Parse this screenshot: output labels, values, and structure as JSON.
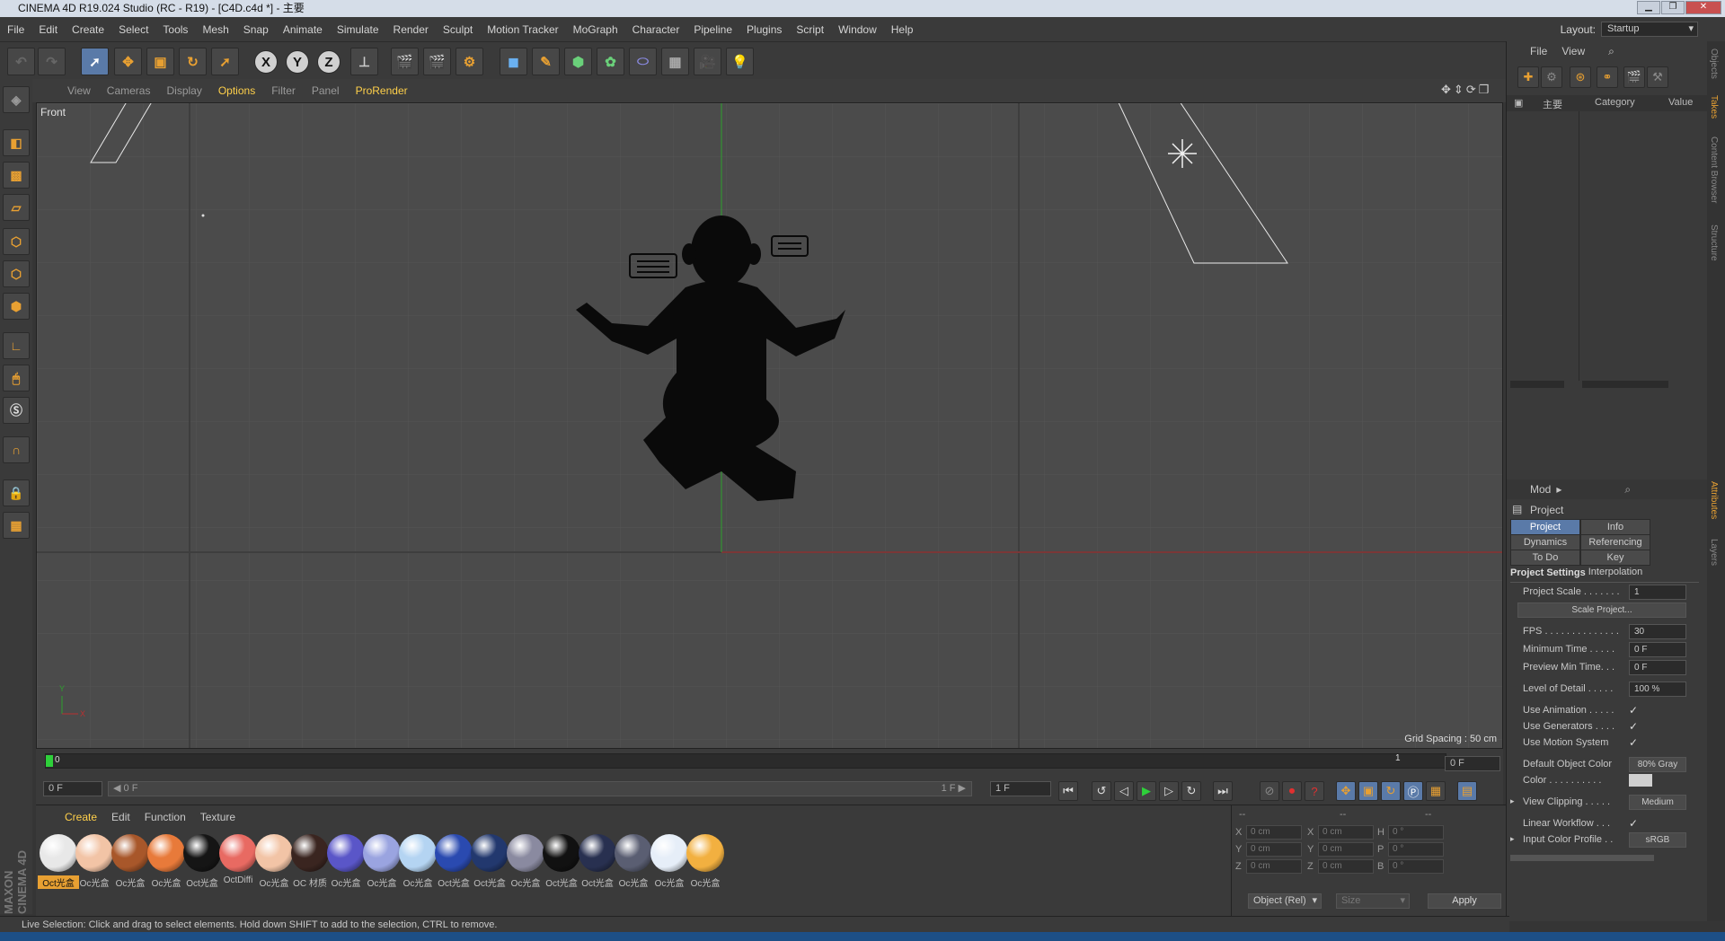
{
  "window": {
    "title": "CINEMA 4D R19.024 Studio (RC - R19) - [C4D.c4d *] - 主要",
    "layout_label": "Layout:",
    "layout_value": "Startup"
  },
  "menubar": [
    "File",
    "Edit",
    "Create",
    "Select",
    "Tools",
    "Mesh",
    "Snap",
    "Animate",
    "Simulate",
    "Render",
    "Sculpt",
    "Motion Tracker",
    "MoGraph",
    "Character",
    "Pipeline",
    "Plugins",
    "Script",
    "Window",
    "Help"
  ],
  "toolbar": {
    "axis_x": "X",
    "axis_y": "Y",
    "axis_z": "Z"
  },
  "viewport": {
    "menu": [
      "View",
      "Cameras",
      "Display",
      "Options",
      "Filter",
      "Panel",
      "ProRender"
    ],
    "highlight": [
      "Options",
      "ProRender"
    ],
    "name": "Front",
    "grid_spacing": "Grid Spacing : 50 cm",
    "axis_y": "Y",
    "axis_x": "X"
  },
  "timeline": {
    "start_marker": "0",
    "end_marker": "1",
    "current_frame_field": "0 F",
    "start_field": "0 F",
    "range_left": "◀ 0 F",
    "range_right": "1 F ▶",
    "end_field": "1 F"
  },
  "materials": {
    "menu": [
      "Create",
      "Edit",
      "Function",
      "Texture"
    ],
    "items": [
      {
        "name": "Oct光盒",
        "color": "#e8e8e8",
        "selected": true
      },
      {
        "name": "Oc光盒",
        "color": "#f2c4a6"
      },
      {
        "name": "Oc光盒",
        "color": "#a8572a"
      },
      {
        "name": "Oc光盒",
        "color": "#e87a3a"
      },
      {
        "name": "Oct光盒",
        "color": "#151515"
      },
      {
        "name": "OctDiffi",
        "color": "#e86a62"
      },
      {
        "name": "Oc光盒",
        "color": "#f2c4a6"
      },
      {
        "name": "OC 材质",
        "color": "#3a2520"
      },
      {
        "name": "Oc光盒",
        "color": "#5a56c8"
      },
      {
        "name": "Oc光盒",
        "color": "#9aa4e0"
      },
      {
        "name": "Oc光盒",
        "color": "#b4d4f2"
      },
      {
        "name": "Oct光盒",
        "color": "#2a4ab0"
      },
      {
        "name": "Oct光盒",
        "color": "#22386e"
      },
      {
        "name": "Oc光盒",
        "color": "#8a8aa0"
      },
      {
        "name": "Oct光盒",
        "color": "#111111"
      },
      {
        "name": "Oct光盒",
        "color": "#283050"
      },
      {
        "name": "Oc光盒",
        "color": "#5a5e72"
      },
      {
        "name": "Oc光盒",
        "color": "#e6eef8"
      },
      {
        "name": "Oc光盒",
        "color": "#f2b040"
      }
    ]
  },
  "coords": {
    "headers": [
      "--",
      "--",
      "--"
    ],
    "rows": [
      {
        "a": "X",
        "av": "0 cm",
        "b": "X",
        "bv": "0 cm",
        "c": "H",
        "cv": "0 °"
      },
      {
        "a": "Y",
        "av": "0 cm",
        "b": "Y",
        "bv": "0 cm",
        "c": "P",
        "cv": "0 °"
      },
      {
        "a": "Z",
        "av": "0 cm",
        "b": "Z",
        "bv": "0 cm",
        "c": "B",
        "cv": "0 °"
      }
    ],
    "mode": "Object (Rel)",
    "size": "Size",
    "apply": "Apply"
  },
  "status": "Live Selection: Click and drag to select elements. Hold down SHIFT to add to the selection, CTRL to remove.",
  "objects": {
    "menu": [
      "File",
      "View"
    ],
    "tree_root": "主要",
    "col_category": "Category",
    "col_value": "Value"
  },
  "attributes": {
    "mode": "Mod",
    "object": "Project",
    "tabs": [
      {
        "label": "Project Settings",
        "on": true
      },
      {
        "label": "Info",
        "on": false
      },
      {
        "label": "Dynamics",
        "on": false
      },
      {
        "label": "Referencing",
        "on": false
      },
      {
        "label": "To Do",
        "on": false
      },
      {
        "label": "Key Interpolation",
        "on": false
      }
    ],
    "section": "Project Settings",
    "project_scale_label": "Project Scale . . . . . . .",
    "project_scale": "1",
    "scale_button": "Scale Project...",
    "fps_label": "FPS . . . . . . . . . . . . . .",
    "fps": "30",
    "min_time_label": "Minimum Time . . . . .",
    "min_time": "0 F",
    "preview_min_label": "Preview Min Time. . .",
    "preview_min": "0 F",
    "lod_label": "Level of Detail . . . . .",
    "lod": "100 %",
    "use_anim_label": "Use Animation . . . . .",
    "use_gen_label": "Use Generators . . . .",
    "use_motion_label": "Use Motion System",
    "check": "✓",
    "def_color_label": "Default Object Color",
    "def_color": "80% Gray",
    "color_label": "Color . . . . . . . . . .",
    "view_clip_label": "View Clipping . . . . .",
    "view_clip": "Medium",
    "linear_label": "Linear Workflow . . .",
    "input_profile_label": "Input Color Profile . .",
    "input_profile": "sRGB"
  },
  "side_tabs": [
    "Objects",
    "Takes",
    "Content Browser",
    "Structure",
    "Attributes",
    "Layers"
  ],
  "brand": "MAXON CINEMA 4D"
}
